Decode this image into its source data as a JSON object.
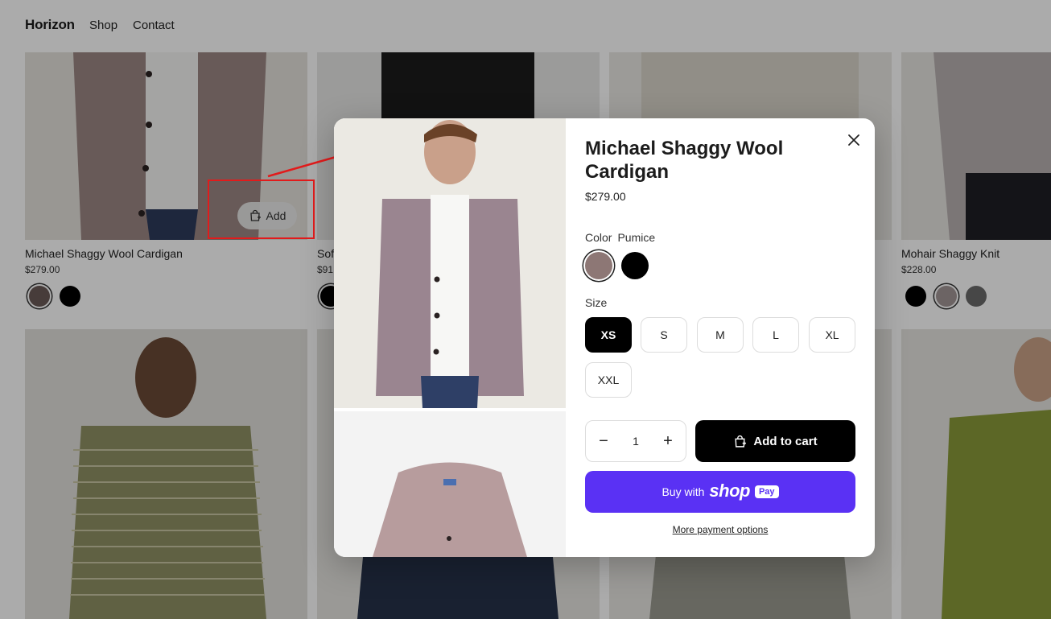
{
  "header": {
    "logo": "Horizon",
    "nav": [
      "Shop",
      "Contact"
    ]
  },
  "grid": {
    "products": [
      {
        "title": "Michael Shaggy Wool Cardigan",
        "price": "$279.00",
        "swatches": [
          "#6b5a57",
          "#000000"
        ]
      },
      {
        "title": "Sof",
        "price": "$91",
        "swatches": [
          "#000000"
        ]
      },
      {
        "title": "Mohair Shaggy Knit",
        "price": "$228.00",
        "swatches": [
          "#000000",
          "#a29696",
          "#6b6b6b"
        ]
      }
    ],
    "add_button_label": "Add"
  },
  "modal": {
    "title": "Michael Shaggy Wool Cardigan",
    "price": "$279.00",
    "color_label": "Color",
    "color_value": "Pumice",
    "color_swatches": [
      "#8d7775",
      "#000000"
    ],
    "size_label": "Size",
    "sizes": [
      "XS",
      "S",
      "M",
      "L",
      "XL",
      "XXL"
    ],
    "selected_size": "XS",
    "quantity": "1",
    "quantity_decrease": "−",
    "quantity_increase": "+",
    "add_to_cart_label": "Add to cart",
    "buy_with_label": "Buy with",
    "shop_word": "shop",
    "pay_badge": "Pay",
    "more_payment_label": "More payment options"
  },
  "colors": {
    "overlay": "rgba(0,0,0,0.33)",
    "annotation": "#e21b1b",
    "shop_pay": "#5a31f4",
    "primary_button": "#000000"
  }
}
